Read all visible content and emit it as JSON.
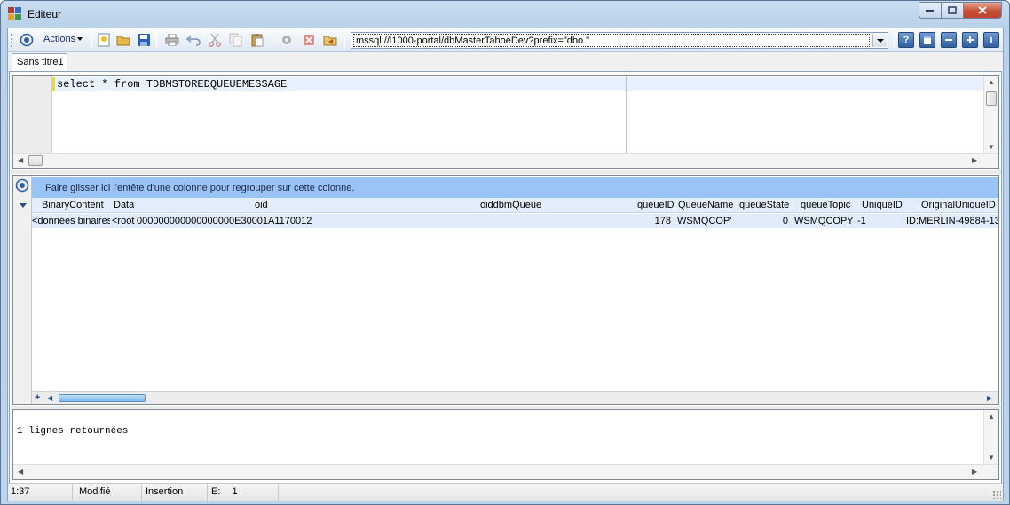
{
  "window": {
    "title": "Editeur"
  },
  "toolbar": {
    "actions_label": "Actions",
    "connection_value": "mssql://l1000-portal/dbMasterTahoeDev?prefix=\"dbo.\"",
    "icons": [
      "connect-icon",
      "new-icon",
      "open-folder-icon",
      "save-icon",
      "print-icon",
      "undo-icon",
      "cut-icon",
      "copy-icon",
      "paste-icon",
      "execute-icon",
      "cancel-icon",
      "export-icon",
      "help-icon",
      "layout-icon",
      "minus-icon",
      "plus-icon",
      "info-icon"
    ]
  },
  "tabs": [
    {
      "label": "Sans titre1"
    }
  ],
  "editor": {
    "sql_text": "select * from TDBMSTOREDQUEUEMESSAGE"
  },
  "grid": {
    "group_panel_text": "Faire glisser ici l'entête d'une colonne pour regrouper sur cette colonne.",
    "columns": [
      "BinaryContent",
      "Data",
      "oid",
      "oiddbmQueue",
      "queueID",
      "QueueName",
      "queueState",
      "queueTopic",
      "UniqueID",
      "OriginalUniqueID"
    ],
    "rows": [
      {
        "BinaryContent": "<données binaires",
        "Data": "<root",
        "oid": "000000000000000000E30001A1170012",
        "oiddbmQueue": "",
        "queueID": "178",
        "QueueName": "WSMQCOP'",
        "queueState": "0",
        "queueTopic": "WSMQCOPY",
        "UniqueID": "-1",
        "OriginalUniqueID": "ID:MERLIN-49884-13"
      }
    ],
    "add_label": "+"
  },
  "messages": {
    "text": "1 lignes retournées"
  },
  "statusbar": {
    "position": "1:37",
    "modified": "Modifié",
    "mode": "Insertion",
    "e_label": "E:",
    "e_value": "1"
  },
  "colors": {
    "group_panel": "#99c4f5",
    "row_selected": "#e0ecfb",
    "header": "#e3eefc"
  }
}
